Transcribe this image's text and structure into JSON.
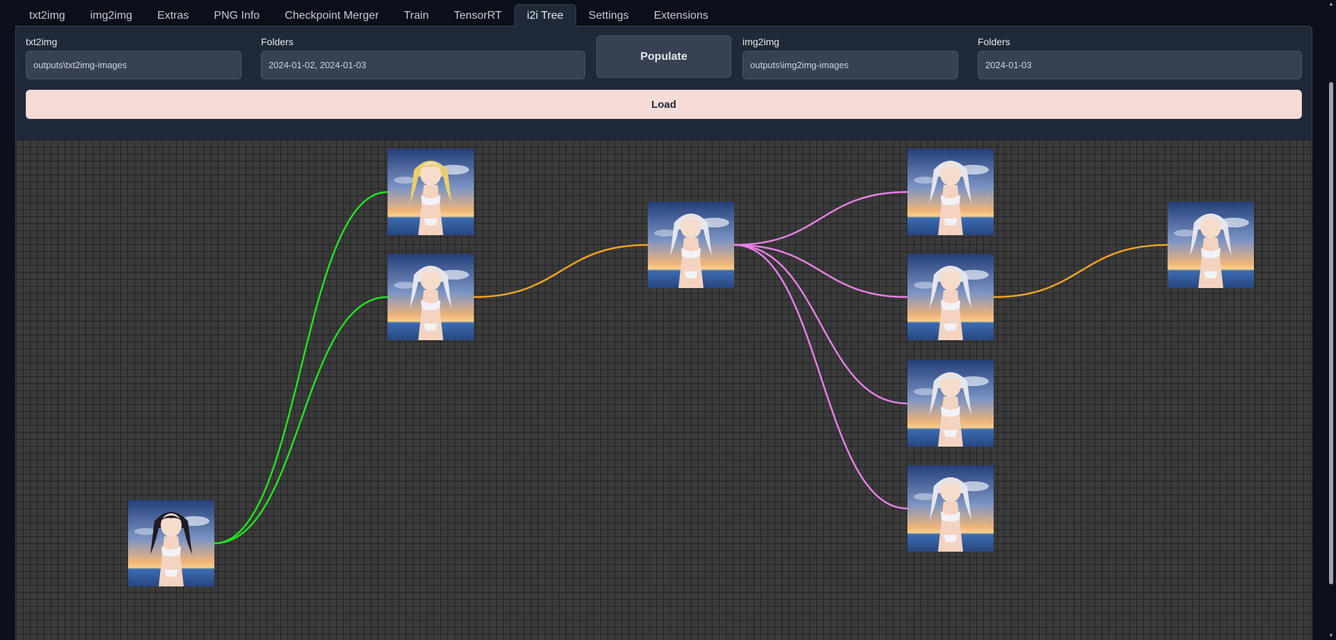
{
  "tabs": [
    {
      "label": "txt2img"
    },
    {
      "label": "img2img"
    },
    {
      "label": "Extras"
    },
    {
      "label": "PNG Info"
    },
    {
      "label": "Checkpoint Merger"
    },
    {
      "label": "Train"
    },
    {
      "label": "TensorRT"
    },
    {
      "label": "i2i Tree",
      "active": true
    },
    {
      "label": "Settings"
    },
    {
      "label": "Extensions"
    }
  ],
  "controls": {
    "txt2img": {
      "label": "txt2img",
      "value": "outputs\\txt2img-images"
    },
    "txt2img_folders": {
      "label": "Folders",
      "value": "2024-01-02, 2024-01-03"
    },
    "populate_label": "Populate",
    "img2img": {
      "label": "img2img",
      "value": "outputs\\img2img-images"
    },
    "img2img_folders": {
      "label": "Folders",
      "value": "2024-01-03"
    },
    "load_label": "Load"
  },
  "tree": {
    "nodes": [
      {
        "id": "root",
        "hair": "#1f1a24"
      },
      {
        "id": "blonde",
        "hair": "#e8cf6e"
      },
      {
        "id": "white-a",
        "hair": "#e4e6ee"
      },
      {
        "id": "white-center",
        "hair": "#e4e6ee"
      },
      {
        "id": "white-c1",
        "hair": "#e4e6ee"
      },
      {
        "id": "white-c2",
        "hair": "#e4e6ee"
      },
      {
        "id": "white-c3",
        "hair": "#e4e6ee"
      },
      {
        "id": "white-c4",
        "hair": "#e4e6ee"
      },
      {
        "id": "white-far",
        "hair": "#e4e6ee"
      }
    ],
    "edges": [
      {
        "from": "root",
        "to": "blonde",
        "color": "#22e222"
      },
      {
        "from": "root",
        "to": "white-a",
        "color": "#22e222"
      },
      {
        "from": "white-a",
        "to": "white-center",
        "color": "#f0a322"
      },
      {
        "from": "white-center",
        "to": "white-c1",
        "color": "#e680e6"
      },
      {
        "from": "white-center",
        "to": "white-c2",
        "color": "#e680e6"
      },
      {
        "from": "white-center",
        "to": "white-c3",
        "color": "#e680e6"
      },
      {
        "from": "white-center",
        "to": "white-c4",
        "color": "#e680e6"
      },
      {
        "from": "white-c2",
        "to": "white-far",
        "color": "#f0a322"
      }
    ]
  },
  "colors": {
    "background": "#0b0f19",
    "panel": "#1f2937",
    "canvas": "#3b3b3b",
    "load_button": "#f6dcd7"
  }
}
